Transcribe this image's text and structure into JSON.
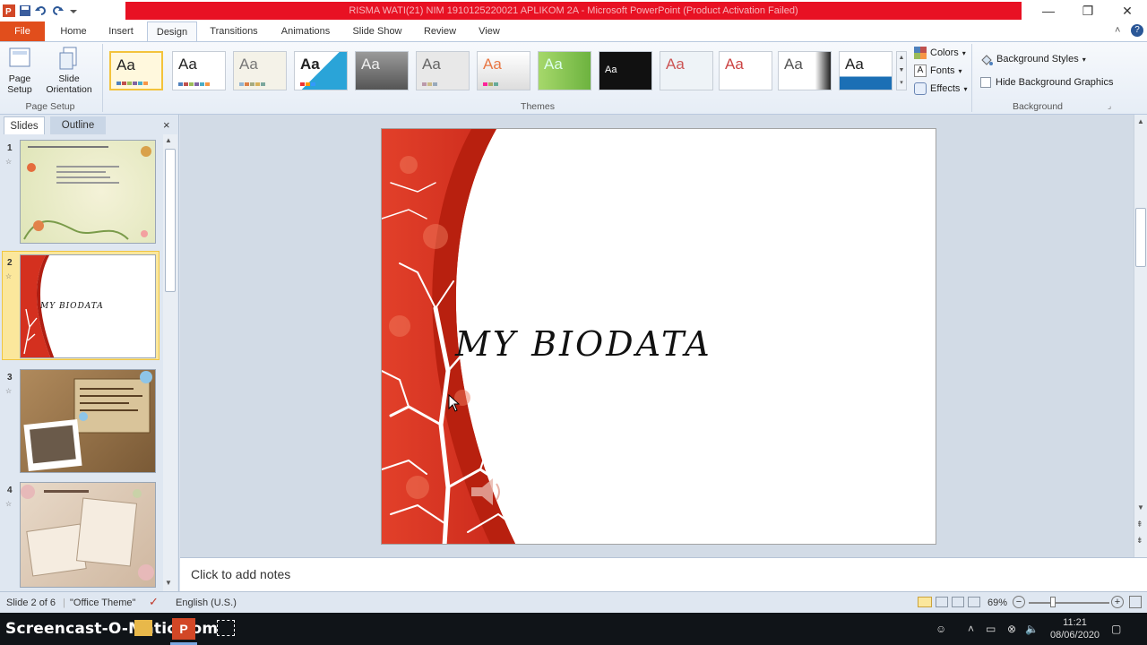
{
  "window": {
    "title": "RISMA WATI(21) NIM 1910125220021 APLIKOM 2A  -  Microsoft PowerPoint (Product Activation Failed)",
    "accent_color": "#e81123"
  },
  "tabs": [
    "File",
    "Home",
    "Insert",
    "Design",
    "Transitions",
    "Animations",
    "Slide Show",
    "Review",
    "View"
  ],
  "ribbon": {
    "page_setup": {
      "page_setup_label": "Page Setup",
      "orientation_label": "Slide Orientation",
      "group_label": "Page Setup"
    },
    "themes": {
      "group_label": "Themes",
      "sample_text": "Aa"
    },
    "theme_options": {
      "colors": "Colors",
      "fonts": "Fonts",
      "effects": "Effects"
    },
    "background": {
      "styles": "Background Styles",
      "hide_graphics": "Hide Background Graphics",
      "group_label": "Background"
    }
  },
  "left_pane": {
    "tabs": [
      "Slides",
      "Outline"
    ],
    "thumbnails": [
      {
        "number": "1"
      },
      {
        "number": "2",
        "title": "MY BIODATA"
      },
      {
        "number": "3"
      },
      {
        "number": "4"
      }
    ]
  },
  "slide": {
    "title": "MY BIODATA"
  },
  "notes": {
    "placeholder": "Click to add notes"
  },
  "status_bar": {
    "slide_info": "Slide 2 of 6",
    "theme": "\"Office Theme\"",
    "language": "English (U.S.)",
    "zoom": "69%"
  },
  "taskbar": {
    "watermark": "Screencast-O-Matic.com",
    "time": "11:21",
    "date": "08/06/2020"
  }
}
